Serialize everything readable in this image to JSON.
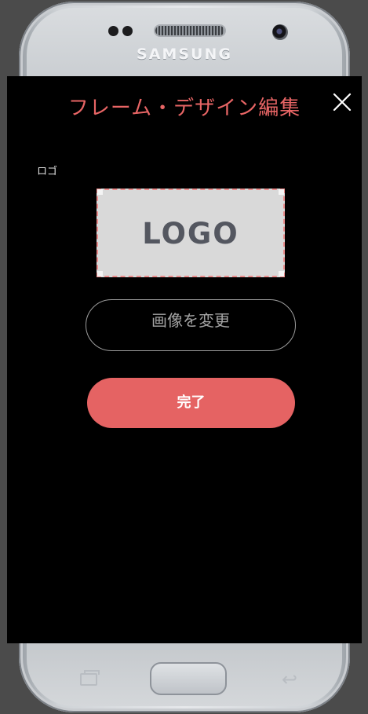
{
  "device": {
    "brand": "SAMSUNG"
  },
  "modal": {
    "title": "フレーム・デザイン編集",
    "close_icon": "close-icon",
    "logo_section": {
      "label": "ロゴ",
      "placeholder_text": "LOGO"
    },
    "change_image_label": "画像を変更",
    "done_label": "完了"
  },
  "colors": {
    "accent": "#e56363",
    "title": "#e86565",
    "modal_background": "#000000",
    "dashed_border": "#e98a8a"
  }
}
